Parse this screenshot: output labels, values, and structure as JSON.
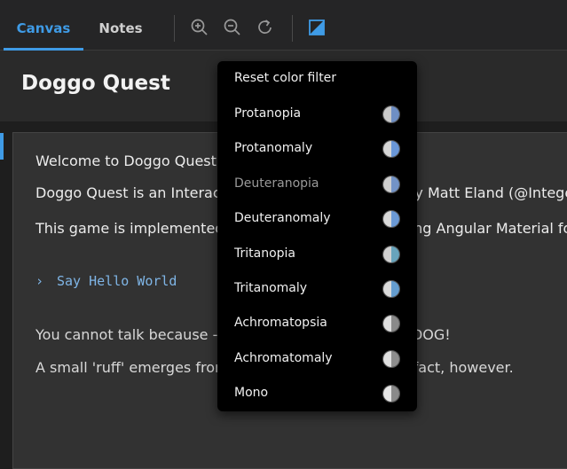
{
  "tabs": [
    {
      "label": "Canvas",
      "active": true
    },
    {
      "label": "Notes",
      "active": false
    }
  ],
  "toolbar": {
    "icons": [
      "zoom-in-icon",
      "zoom-out-icon",
      "reset-zoom-icon",
      "color-filter-icon"
    ],
    "accent": "#3f9be6"
  },
  "header": {
    "title": "Doggo Quest"
  },
  "content": {
    "line1": "Welcome to Doggo Quest!",
    "line2": "Doggo Quest is an Interactive Fiction game created by Matt Eland (@IntegerM",
    "line3": "This game is implemented in Angular / TypeScript using Angular Material for s",
    "command": "Say Hello World",
    "line5": "You cannot talk because - you are a dog! YOU ARE A DOG!",
    "line6": "A small 'ruff' emerges from you. Nobody notices this fact, however."
  },
  "menu": {
    "reset_label": "Reset color filter",
    "items": [
      {
        "label": "Protanopia",
        "left": "#c9c9c9",
        "right": "#6f8fc4",
        "dim": false
      },
      {
        "label": "Protanomaly",
        "left": "#d6d6d6",
        "right": "#6a97d8",
        "dim": false
      },
      {
        "label": "Deuteranopia",
        "left": "#cfcfcf",
        "right": "#7393c6",
        "dim": true
      },
      {
        "label": "Deuteranomaly",
        "left": "#d9d9d9",
        "right": "#6c9ad6",
        "dim": false
      },
      {
        "label": "Tritanopia",
        "left": "#d2d2d2",
        "right": "#68a4bc",
        "dim": false
      },
      {
        "label": "Tritanomaly",
        "left": "#dadada",
        "right": "#659dcf",
        "dim": false
      },
      {
        "label": "Achromatopsia",
        "left": "#e0e0e0",
        "right": "#8a8a8a",
        "dim": false
      },
      {
        "label": "Achromatomaly",
        "left": "#e0e0e0",
        "right": "#8e8e8e",
        "dim": false
      },
      {
        "label": "Mono",
        "left": "#e6e6e6",
        "right": "#8a8a8a",
        "dim": false
      }
    ]
  }
}
